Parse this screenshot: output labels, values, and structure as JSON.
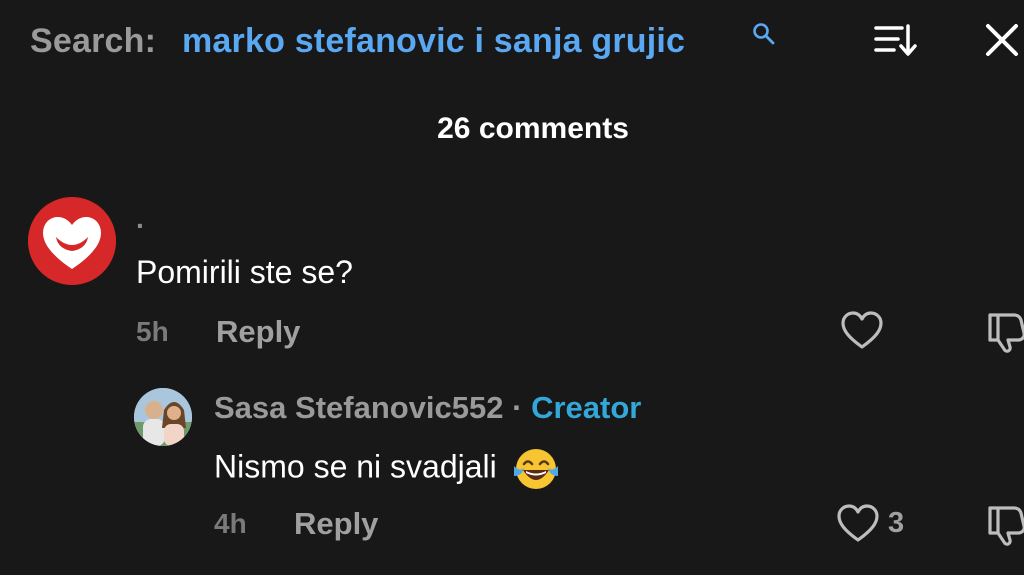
{
  "search": {
    "label": "Search:",
    "query": "marko stefanovic i sanja grujic"
  },
  "comments_count_label": "26 comments",
  "comments": [
    {
      "username": "·",
      "text": "Pomirili ste se?",
      "time": "5h",
      "reply_label": "Reply",
      "replies": [
        {
          "username": "Sasa Stefanovic552",
          "separator": "·",
          "badge": "Creator",
          "text": "Nismo se ni svadjali",
          "emoji": "face-with-tears-of-joy",
          "time": "4h",
          "reply_label": "Reply",
          "likes": "3"
        }
      ]
    }
  ],
  "colors": {
    "background": "#181818",
    "search_query": "#5aa8f2",
    "creator_badge": "#33a8d8",
    "avatar_red": "#d62828"
  }
}
